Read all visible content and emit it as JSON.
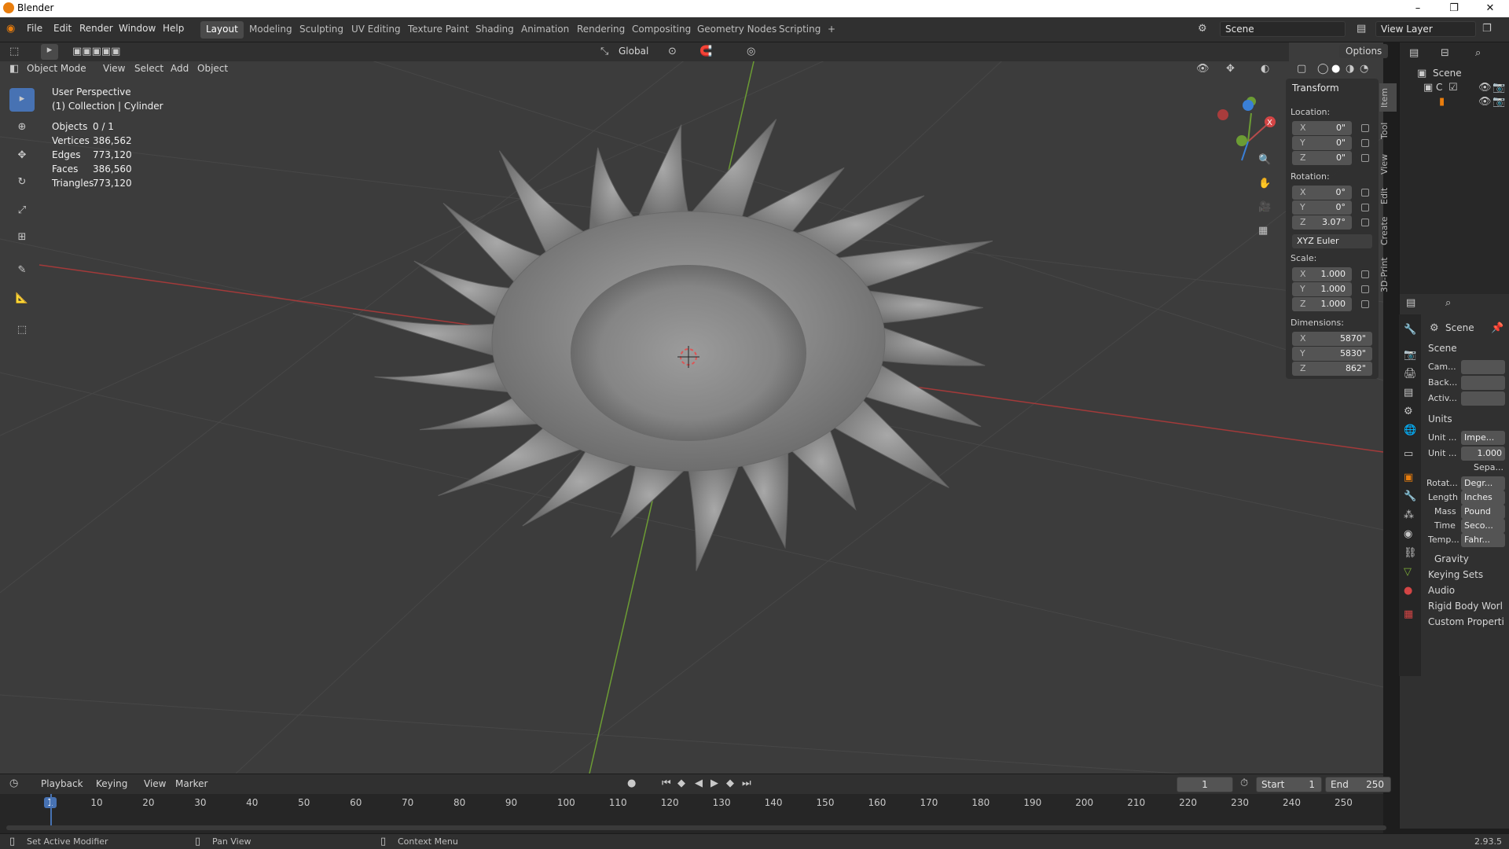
{
  "window": {
    "title": "Blender",
    "minimize": "–",
    "restore": "❐",
    "close": "✕"
  },
  "menus": [
    "File",
    "Edit",
    "Render",
    "Window",
    "Help"
  ],
  "workspaces": [
    "Layout",
    "Modeling",
    "Sculpting",
    "UV Editing",
    "Texture Paint",
    "Shading",
    "Animation",
    "Rendering",
    "Compositing",
    "Geometry Nodes",
    "Scripting",
    "+"
  ],
  "active_workspace": "Layout",
  "scene_field": "Scene",
  "view_layer_field": "View Layer",
  "options_label": "Options",
  "transform_orientation": "Global",
  "viewport_header": {
    "mode": "Object Mode",
    "menus": [
      "View",
      "Select",
      "Add",
      "Object"
    ]
  },
  "overlay": {
    "perspective": "User Perspective",
    "collection": "(1) Collection | Cylinder",
    "stats": [
      {
        "label": "Objects",
        "value": "0 / 1"
      },
      {
        "label": "Vertices",
        "value": "386,562"
      },
      {
        "label": "Edges",
        "value": "773,120"
      },
      {
        "label": "Faces",
        "value": "386,560"
      },
      {
        "label": "Triangles",
        "value": "773,120"
      }
    ]
  },
  "npanel": {
    "title": "Transform",
    "location_label": "Location:",
    "location": [
      {
        "axis": "X",
        "value": "0\""
      },
      {
        "axis": "Y",
        "value": "0\""
      },
      {
        "axis": "Z",
        "value": "0\""
      }
    ],
    "rotation_label": "Rotation:",
    "rotation": [
      {
        "axis": "X",
        "value": "0°"
      },
      {
        "axis": "Y",
        "value": "0°"
      },
      {
        "axis": "Z",
        "value": "3.07°"
      }
    ],
    "rotation_mode": "XYZ Euler",
    "scale_label": "Scale:",
    "scale": [
      {
        "axis": "X",
        "value": "1.000"
      },
      {
        "axis": "Y",
        "value": "1.000"
      },
      {
        "axis": "Z",
        "value": "1.000"
      }
    ],
    "dimensions_label": "Dimensions:",
    "dimensions": [
      {
        "axis": "X",
        "value": "5870\""
      },
      {
        "axis": "Y",
        "value": "5830\""
      },
      {
        "axis": "Z",
        "value": "862\""
      }
    ],
    "tabs": [
      "Item",
      "Tool",
      "View",
      "Edit",
      "Create",
      "3D-Print"
    ]
  },
  "outliner": {
    "root": "Scene",
    "collection": "C"
  },
  "properties": {
    "header": "Scene",
    "section_scene": "Scene",
    "camera_label": "Cam...",
    "background_label": "Back...",
    "active_label": "Activ...",
    "section_units": "Units",
    "unit_system_label": "Unit ...",
    "unit_system": "Impe...",
    "unit_scale_label": "Unit ...",
    "unit_scale": "1.000",
    "separate_label": "Sepa...",
    "rotation_label": "Rotat...",
    "rotation_value": "Degr...",
    "length_label": "Length",
    "length_value": "Inches",
    "mass_label": "Mass",
    "mass_value": "Pound",
    "time_label": "Time",
    "time_value": "Seco...",
    "temp_label": "Temp...",
    "temp_value": "Fahr...",
    "collapsed": [
      "Gravity",
      "Keying Sets",
      "Audio",
      "Rigid Body Worl",
      "Custom Properti"
    ]
  },
  "timeline": {
    "menus": [
      "Playback",
      "Keying",
      "View",
      "Marker"
    ],
    "current_frame": "1",
    "start_label": "Start",
    "start": "1",
    "end_label": "End",
    "end": "250",
    "ticks": [
      "1",
      "10",
      "20",
      "30",
      "40",
      "50",
      "60",
      "70",
      "80",
      "90",
      "100",
      "110",
      "120",
      "130",
      "140",
      "150",
      "160",
      "170",
      "180",
      "190",
      "200",
      "210",
      "220",
      "230",
      "240",
      "250"
    ]
  },
  "statusbar": {
    "left": "Set Active Modifier",
    "middle": "Pan View",
    "right": "Context Menu",
    "version": "2.93.5"
  },
  "colors": {
    "accent": "#4772b3",
    "x_axis": "#c0392b",
    "y_axis": "#7fb038",
    "z_axis": "#3a7fd6"
  }
}
